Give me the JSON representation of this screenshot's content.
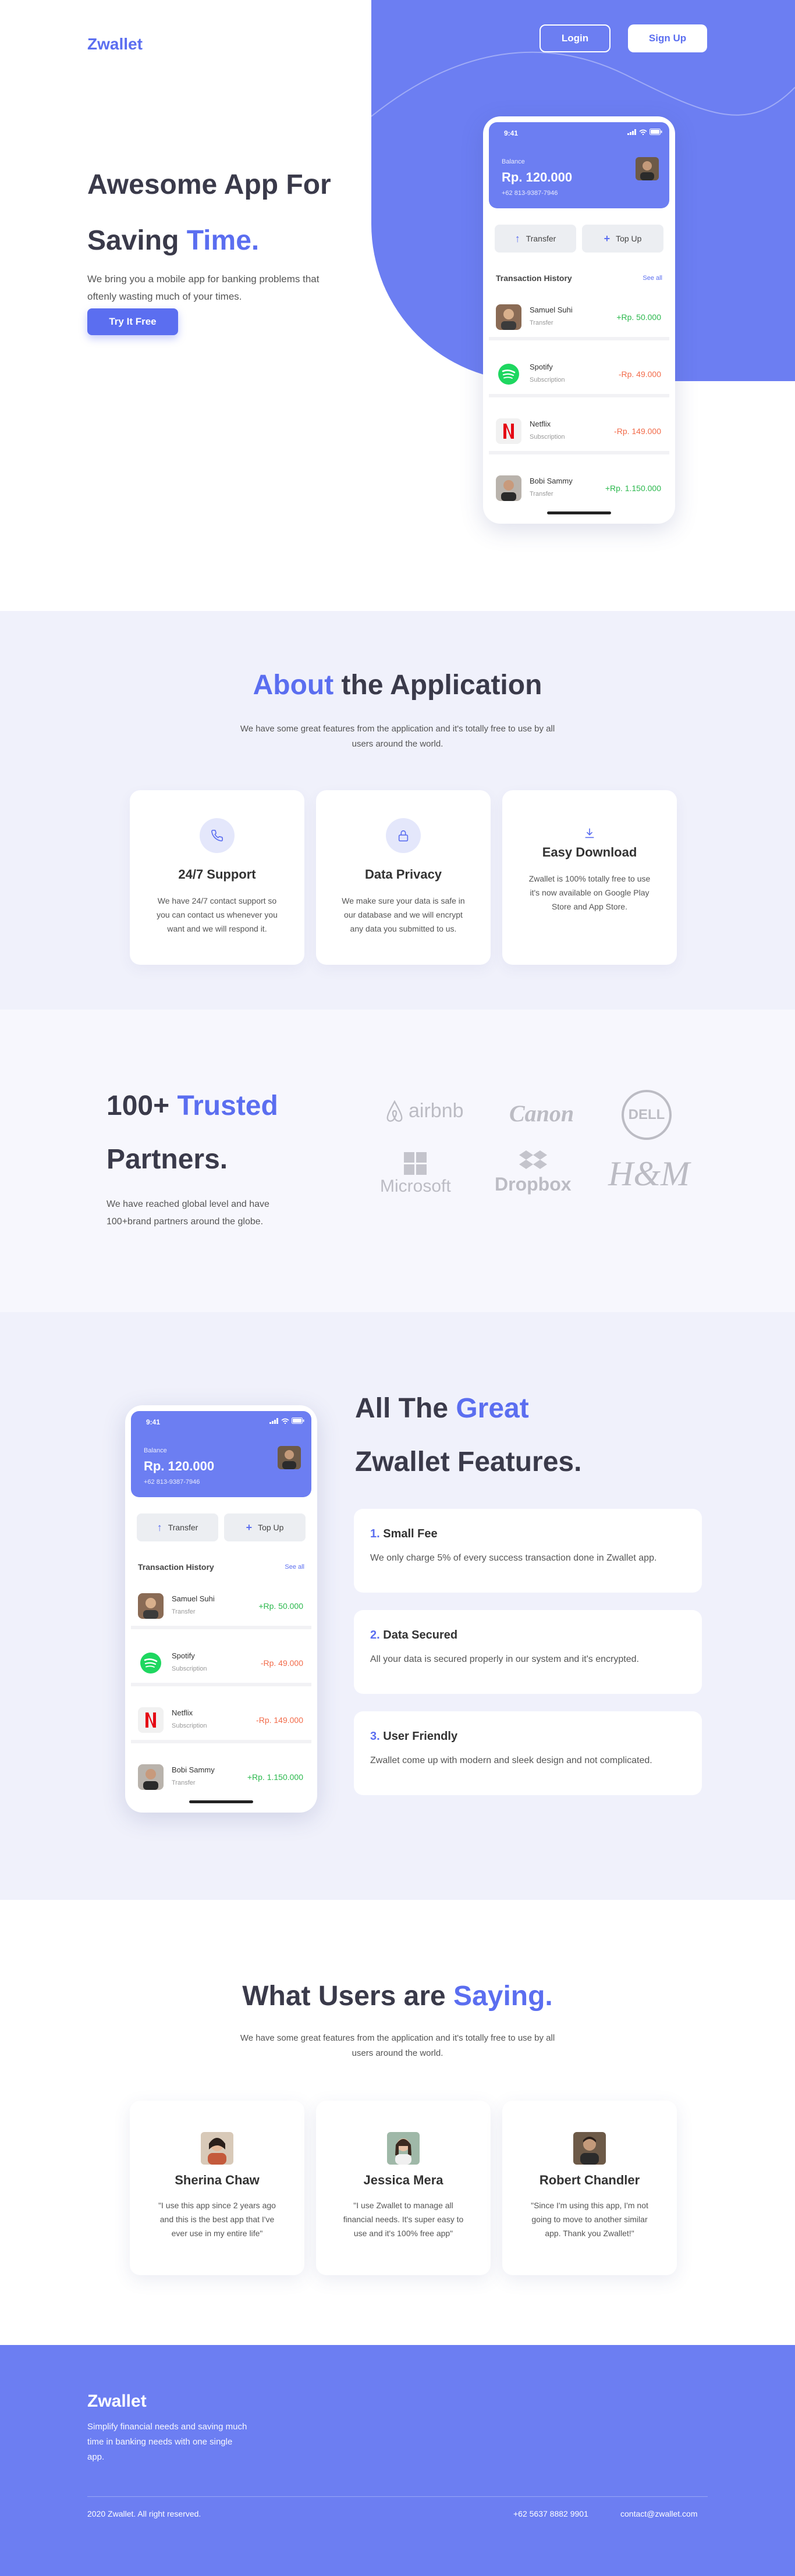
{
  "colors": {
    "accent": "#5b6ef0",
    "hero_blob": "#6c7ef2",
    "positive": "#2bb84d",
    "negative": "#f26b4a",
    "section_bg": "#f0f1fb"
  },
  "header": {
    "brand": "Zwallet",
    "login_label": "Login",
    "signup_label": "Sign Up"
  },
  "hero": {
    "title_line1": "Awesome App For",
    "title_line2_plain": "Saving ",
    "title_line2_accent": "Time.",
    "subtitle": "We bring you a mobile app for banking problems that oftenly wasting much of your times.",
    "cta_label": "Try It Free"
  },
  "phone": {
    "time": "9:41",
    "balance_label": "Balance",
    "balance_amount": "Rp. 120.000",
    "account_number": "+62 813-9387-7946",
    "transfer_label": "Transfer",
    "topup_label": "Top Up",
    "history_title": "Transaction History",
    "see_all": "See all",
    "transactions": [
      {
        "name": "Samuel Suhi",
        "type": "Transfer",
        "amount": "+Rp. 50.000",
        "sign": "pos",
        "icon": "person-avatar"
      },
      {
        "name": "Spotify",
        "type": "Subscription",
        "amount": "-Rp. 49.000",
        "sign": "neg",
        "icon": "spotify-icon"
      },
      {
        "name": "Netflix",
        "type": "Subscription",
        "amount": "-Rp. 149.000",
        "sign": "neg",
        "icon": "netflix-icon"
      },
      {
        "name": "Bobi Sammy",
        "type": "Transfer",
        "amount": "+Rp. 1.150.000",
        "sign": "pos",
        "icon": "person-avatar"
      }
    ]
  },
  "about": {
    "title_accent": "About",
    "title_plain": " the Application",
    "subtitle": "We have some great features from the application and it's totally free to use by all users around the world.",
    "cards": [
      {
        "title": "24/7 Support",
        "text": "We have 24/7 contact support so you can contact us whenever you want and we will respond it.",
        "icon": "phone-icon"
      },
      {
        "title": "Data Privacy",
        "text": "We make sure your data is safe in our database and we will encrypt any data you submitted to us.",
        "icon": "lock-icon"
      },
      {
        "title": "Easy Download",
        "text": "Zwallet is 100% totally free to use it's now available on Google Play Store and App Store.",
        "icon": "download-icon"
      }
    ]
  },
  "partners": {
    "title_plain1": "100+ ",
    "title_accent": "Trusted",
    "title_plain2": "Partners.",
    "subtitle": "We have reached global level and have 100+brand partners around the globe.",
    "logos": [
      "airbnb",
      "Canon",
      "DELL",
      "Microsoft",
      "Dropbox",
      "H&M"
    ]
  },
  "features": {
    "title_plain1": "All The ",
    "title_accent": "Great",
    "title_plain2": "Zwallet Features.",
    "items": [
      {
        "num": "1.",
        "title": "Small Fee",
        "text": "We only charge 5% of every success transaction done in Zwallet app."
      },
      {
        "num": "2.",
        "title": "Data Secured",
        "text": "All your data is secured properly in our system and it's encrypted."
      },
      {
        "num": "3.",
        "title": "User Friendly",
        "text": "Zwallet come up with modern and sleek design and not complicated."
      }
    ]
  },
  "testimonials": {
    "title_plain": "What Users are ",
    "title_accent": "Saying.",
    "subtitle": "We have some great features from the application and it's totally free to use by all users around the world.",
    "items": [
      {
        "name": "Sherina Chaw",
        "quote": "\"I use this app since 2 years ago and this is the best app that I've ever use in my entire life\""
      },
      {
        "name": "Jessica Mera",
        "quote": "\"I use Zwallet to manage all financial needs. It's super easy to use and it's 100% free app\""
      },
      {
        "name": "Robert Chandler",
        "quote": "\"Since I'm using this app, I'm not going to move to another similar app. Thank you Zwallet!\""
      }
    ]
  },
  "footer": {
    "brand": "Zwallet",
    "tagline": "Simplify financial needs and saving much time in banking needs with one single app.",
    "copyright": "2020 Zwallet. All right reserved.",
    "phone": "+62 5637 8882 9901",
    "email": "contact@zwallet.com"
  }
}
